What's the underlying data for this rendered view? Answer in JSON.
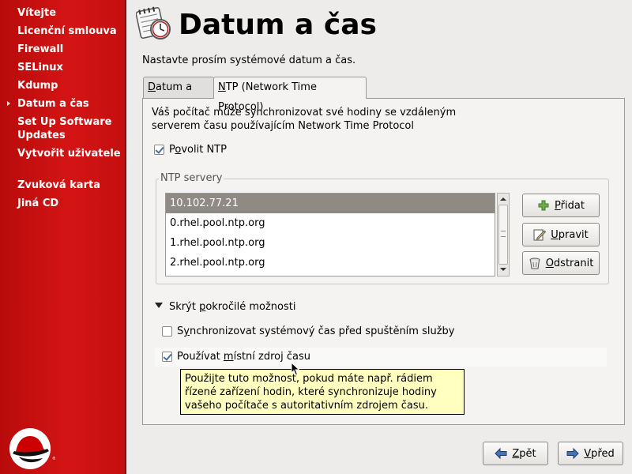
{
  "sidebar": {
    "items": [
      {
        "label": "Vítejte"
      },
      {
        "label": "Licenční smlouva"
      },
      {
        "label": "Firewall"
      },
      {
        "label": "SELinux"
      },
      {
        "label": "Kdump"
      },
      {
        "label": "Datum a čas",
        "active": true
      },
      {
        "label": "Set Up Software Updates"
      },
      {
        "label": "Vytvořit uživatele"
      },
      {
        "label": "Zvuková karta"
      },
      {
        "label": "Jiná CD"
      }
    ]
  },
  "header": {
    "title": "Datum a čas",
    "subtitle": "Nastavte prosím systémové datum a čas."
  },
  "tabs": [
    {
      "label": "Datum a čas",
      "mnemonic": "D",
      "rest": "atum a čas"
    },
    {
      "label": "NTP (Network Time Protocol)",
      "mnemonic": "N",
      "rest": "TP (Network Time Protocol)",
      "active": true
    }
  ],
  "ntp": {
    "description": "Váš počítač může synchronizovat své hodiny se vzdáleným serverem času používajícím Network Time Protocol",
    "enable_label_pre": "P",
    "enable_label_mn": "o",
    "enable_label_post": "volit NTP",
    "enable_checked": true,
    "servers_frame_title": "NTP servery",
    "servers": [
      {
        "host": "10.102.77.21",
        "selected": true
      },
      {
        "host": "0.rhel.pool.ntp.org"
      },
      {
        "host": "1.rhel.pool.ntp.org"
      },
      {
        "host": "2.rhel.pool.ntp.org"
      }
    ],
    "buttons": {
      "add_mn": "P",
      "add_rest": "řidat",
      "edit_mn": "U",
      "edit_rest": "pravit",
      "remove_mn": "O",
      "remove_rest": "dstranit"
    },
    "advanced": {
      "toggle_pre": "Skrýt ",
      "toggle_mn": "p",
      "toggle_post": "okročilé možnosti",
      "sync_pre": "S",
      "sync_mn": "y",
      "sync_post": "nchronizovat systémový čas před spuštěním služby",
      "sync_checked": false,
      "local_pre": "Používat ",
      "local_mn": "m",
      "local_post": "ístní zdroj času",
      "local_checked": true
    },
    "tooltip": "Použijte tuto možnost, pokud máte např. rádiem řízené zařízení hodin, které synchronizuje hodiny vašeho počítače s autoritativním zdrojem času."
  },
  "nav": {
    "back_mn": "Z",
    "back_rest": "pět",
    "forward_mn": "V",
    "forward_rest": "před"
  },
  "colors": {
    "sidebar_red": "#cc1111",
    "selection": "#8f8a83",
    "tooltip_bg": "#ffffbf"
  }
}
